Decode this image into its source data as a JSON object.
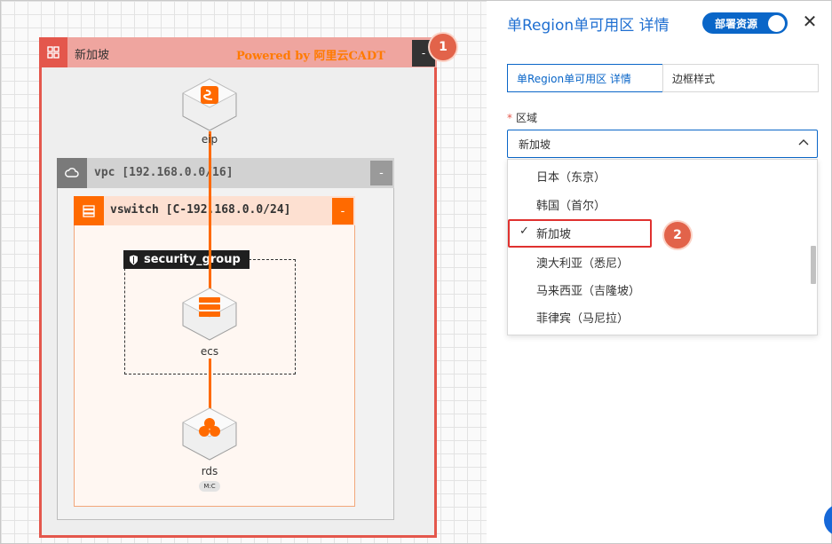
{
  "diagram": {
    "region": {
      "title": "新加坡",
      "powered_by": "Powered by 阿里云CADT",
      "collapse_label": "-",
      "badge": "1"
    },
    "vpc": {
      "title": "vpc [192.168.0.0/16]",
      "collapse_label": "-"
    },
    "vswitch": {
      "title": "vswitch [C-192.168.0.0/24]",
      "collapse_label": "-"
    },
    "security_group": {
      "title": "security_group"
    },
    "nodes": {
      "eip": "eip",
      "ecs": "ecs",
      "rds": "rds",
      "rds_tag": "M:C"
    }
  },
  "panel": {
    "title": "单Region单可用区 详情",
    "deploy_toggle_label": "部署资源",
    "close_label": "✕",
    "tabs": [
      {
        "label": "单Region单可用区 详情"
      },
      {
        "label": "边框样式"
      }
    ],
    "field": {
      "required_mark": "*",
      "label": "区域",
      "value": "新加坡"
    },
    "options": [
      {
        "label": "日本（东京）"
      },
      {
        "label": "韩国（首尔）"
      },
      {
        "label": "新加坡"
      },
      {
        "label": "澳大利亚（悉尼）"
      },
      {
        "label": "马来西亚（吉隆坡）"
      },
      {
        "label": "菲律宾（马尼拉）"
      }
    ],
    "selected_check": "✓",
    "badge": "2"
  },
  "colors": {
    "accent": "#0a66c8",
    "region_red": "#e4574c",
    "orange": "#ff6a00"
  }
}
